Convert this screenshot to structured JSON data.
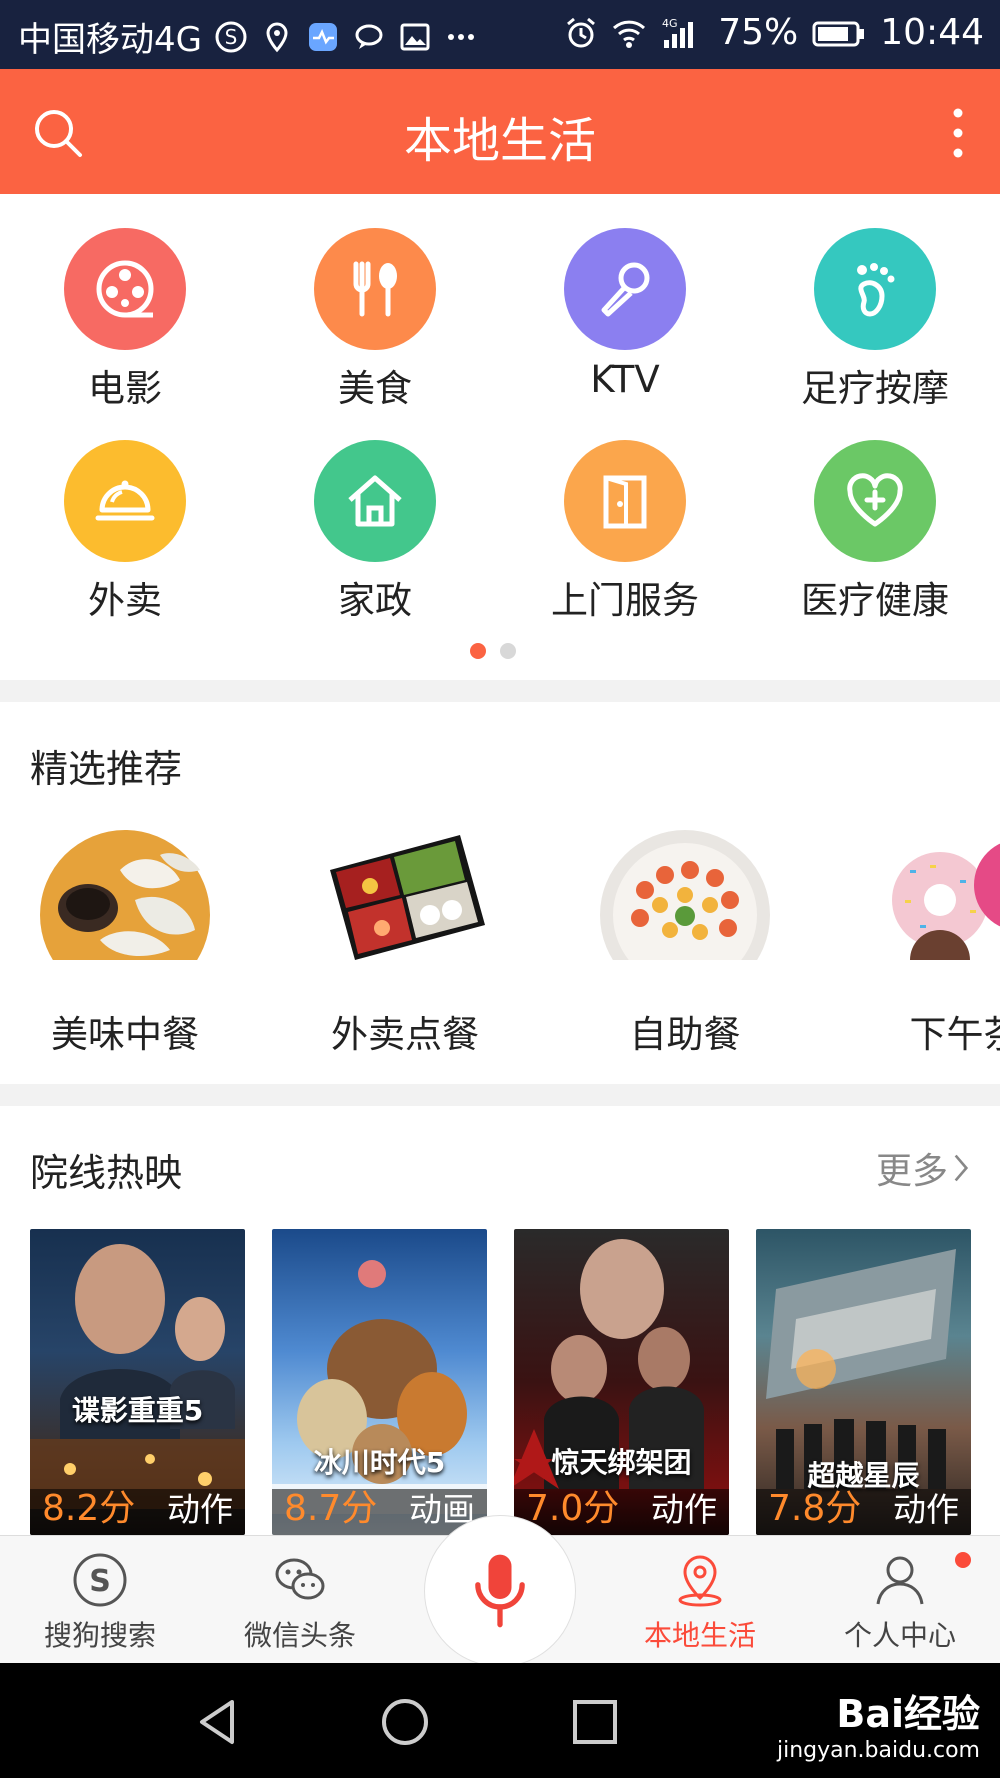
{
  "status_bar": {
    "carrier": "中国移动4G",
    "battery": "75%",
    "time": "10:44",
    "network": "4G"
  },
  "header": {
    "title": "本地生活"
  },
  "categories": [
    {
      "label": "电影",
      "color": "#f76a63",
      "icon": "film-reel-icon"
    },
    {
      "label": "美食",
      "color": "#fd8a4b",
      "icon": "fork-spoon-icon"
    },
    {
      "label": "KTV",
      "color": "#8b7ff0",
      "icon": "microphone-icon"
    },
    {
      "label": "足疗按摩",
      "color": "#35c8bf",
      "icon": "footprint-icon"
    },
    {
      "label": "外卖",
      "color": "#fcbc2e",
      "icon": "cloche-icon"
    },
    {
      "label": "家政",
      "color": "#43c78c",
      "icon": "house-icon"
    },
    {
      "label": "上门服务",
      "color": "#fba64c",
      "icon": "door-icon"
    },
    {
      "label": "医疗健康",
      "color": "#6bc866",
      "icon": "heart-plus-icon"
    }
  ],
  "pager": {
    "active_color": "#fb6342",
    "inactive_color": "#d8d8d8"
  },
  "featured": {
    "title": "精选推荐",
    "items": [
      {
        "label": "美味中餐"
      },
      {
        "label": "外卖点餐"
      },
      {
        "label": "自助餐"
      },
      {
        "label": "下午茶"
      }
    ]
  },
  "cinema": {
    "title": "院线热映",
    "more": "更多",
    "movies": [
      {
        "title": "谍影重重5",
        "score": "8.2分",
        "genre": "动作"
      },
      {
        "title": "冰川时代5",
        "score": "8.7分",
        "genre": "动画"
      },
      {
        "title": "惊天绑架团",
        "score": "7.0分",
        "genre": "动作"
      },
      {
        "title": "超越星辰",
        "score": "7.8分",
        "genre": "动作"
      }
    ]
  },
  "tabbar": {
    "items": [
      {
        "label": "搜狗搜索",
        "icon": "sogou-icon"
      },
      {
        "label": "微信头条",
        "icon": "wechat-icon"
      },
      {
        "label": "本地生活",
        "icon": "location-pin-icon",
        "active": true
      },
      {
        "label": "个人中心",
        "icon": "person-icon"
      }
    ],
    "active_color": "#fb4b3a"
  },
  "watermark": {
    "brand": "Bai经验",
    "url": "jingyan.baidu.com"
  }
}
